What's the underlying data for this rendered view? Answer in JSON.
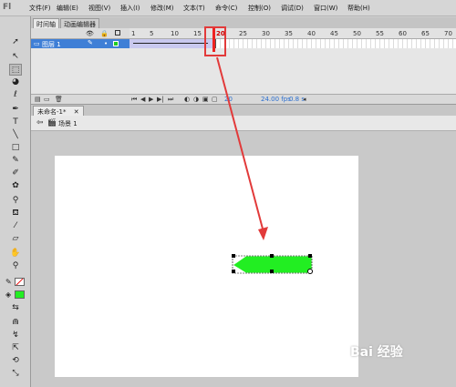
{
  "app": {
    "logo": "Fl"
  },
  "menu": [
    "文件(F)",
    "编辑(E)",
    "视图(V)",
    "插入(I)",
    "修改(M)",
    "文本(T)",
    "命令(C)",
    "控制(O)",
    "调试(D)",
    "窗口(W)",
    "帮助(H)"
  ],
  "panels": {
    "timeline_tab": "时间轴",
    "motion_tab": "动画编辑器"
  },
  "timeline": {
    "layer_name": "图层 1",
    "ruler": [
      "1",
      "5",
      "10",
      "15",
      "20",
      "25",
      "30",
      "35",
      "40",
      "45",
      "50",
      "55",
      "60",
      "65",
      "70"
    ],
    "current_frame": "20",
    "fps": "24.00 fps",
    "time": "0.8 s"
  },
  "document": {
    "tab": "未命名-1*",
    "scene": "场景 1"
  },
  "colors": {
    "fill": "#22ee22",
    "annotation": "#e23a3a",
    "layer_highlight": "#3f7fd6"
  },
  "watermark": "Bai 经验"
}
